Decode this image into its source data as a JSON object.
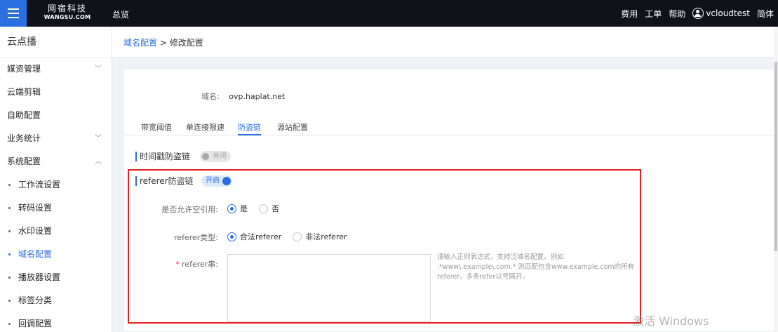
{
  "topbar": {
    "logo_cn": "网宿科技",
    "logo_en": "WANGSU.COM",
    "overview": "总览",
    "right_links": [
      "费用",
      "工单",
      "帮助"
    ],
    "username": "vcloudtest",
    "language": "简体"
  },
  "sidebar": {
    "title": "云点播",
    "items": [
      {
        "label": "媒资管理",
        "chevron": "﹀"
      },
      {
        "label": "云端剪辑"
      },
      {
        "label": "自助配置"
      },
      {
        "label": "业务统计",
        "chevron": "﹀"
      },
      {
        "label": "系统配置",
        "chevron": "︿"
      }
    ],
    "sub_items": [
      "工作流设置",
      "转码设置",
      "水印设置",
      "域名配置",
      "播放器设置",
      "标签分类",
      "回调配置"
    ]
  },
  "breadcrumb": {
    "link": "域名配置",
    "separator": ">",
    "current": "修改配置"
  },
  "form": {
    "domain_label": "域名:",
    "domain_value": "ovp.haplat.net",
    "tabs": [
      "带宽阈值",
      "单连接限速",
      "防盗链",
      "源站配置"
    ],
    "active_tab": "防盗链",
    "timestamp_section": {
      "title": "时间戳防盗链",
      "toggle_label": "关闭",
      "enabled": false
    },
    "referer_section": {
      "title": "referer防盗链",
      "toggle_label": "开启",
      "enabled": true,
      "allow_empty_label": "是否允许空引用:",
      "allow_empty_options": [
        "是",
        "否"
      ],
      "allow_empty_selected": "是",
      "type_label": "referer类型:",
      "type_options": [
        "合法referer",
        "非法referer"
      ],
      "type_selected": "合法referer",
      "string_required_mark": "*",
      "string_label": "referer串:",
      "string_value": "",
      "hint_lines": [
        "请输入正则表达式，支持泛域名配置。例如",
        ".*www\\.example\\.com.* 则匹配包含www.example.com的所有",
        "referer。多条refer以号隔开。"
      ]
    }
  },
  "watermark": "激活 Windows",
  "colors": {
    "primary": "#2b6de0",
    "topbar": "#0f1219",
    "highlight": "#e32121"
  }
}
